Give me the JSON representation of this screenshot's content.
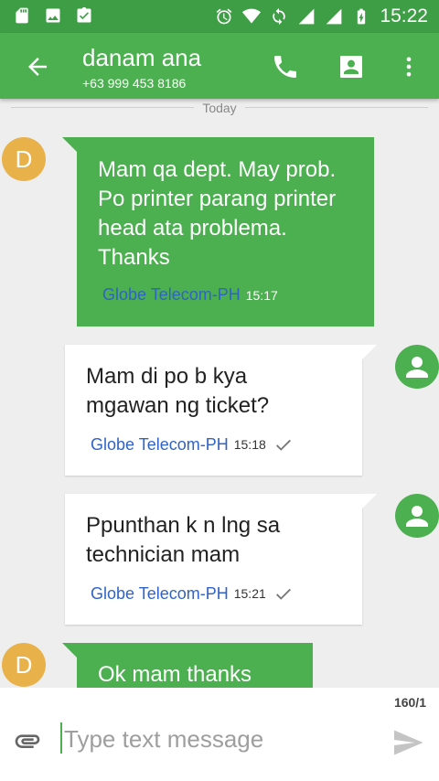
{
  "status_bar": {
    "time": "15:22"
  },
  "header": {
    "name": "danam ana",
    "number": "+63 999 453 8186"
  },
  "date_divider": "Today",
  "messages": [
    {
      "direction": "incoming",
      "avatar": "D",
      "text": "Mam qa dept. May prob. Po printer parang printer head ata problema. Thanks",
      "sim": "Globe Telecom-PH",
      "time": "15:17"
    },
    {
      "direction": "outgoing",
      "text": "Mam di po b kya mgawan ng ticket?",
      "sim": "Globe Telecom-PH",
      "time": "15:18"
    },
    {
      "direction": "outgoing",
      "text": "Ppunthan k n lng sa technician mam",
      "sim": "Globe Telecom-PH",
      "time": "15:21"
    },
    {
      "direction": "incoming",
      "avatar": "D",
      "text": "Ok mam thanks"
    }
  ],
  "compose": {
    "counter": "160/1",
    "placeholder": "Type text message"
  },
  "colors": {
    "toolbar": "#4caf50",
    "status_bar": "#3e9e45",
    "incoming_bubble": "#4caf50",
    "outgoing_bubble": "#ffffff",
    "avatar": "#e8b14a",
    "sim_label": "#2f63c6"
  }
}
